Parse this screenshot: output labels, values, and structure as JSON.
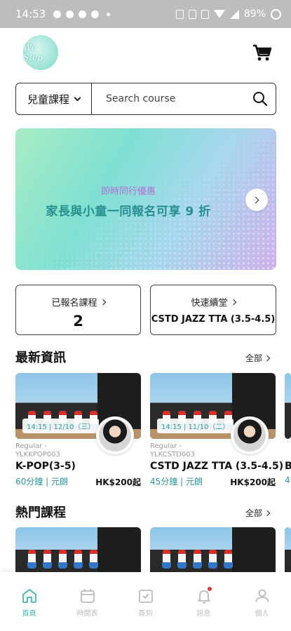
{
  "status_bar": {
    "time": "14:53",
    "battery": "89%"
  },
  "header": {
    "logo_text": "Wé Step"
  },
  "search": {
    "category": "兒童課程",
    "placeholder": "Search course"
  },
  "banner": {
    "subtitle": "即時同行優惠",
    "title": "家長與小童一同報名可享 9 折"
  },
  "quick_cards": {
    "enrolled": {
      "label": "已報名課程",
      "count": "2"
    },
    "quick_checkin": {
      "label": "快速續堂",
      "course": "CSTD JAZZ TTA (3.5-4.5)"
    }
  },
  "news": {
    "title": "最新資訊",
    "more": "全部",
    "courses": [
      {
        "date": "14:15 | 12/10（三）",
        "code_line1": "Regular -",
        "code_line2": "YLKKPOP003",
        "name": "K-POP(3-5)",
        "meta": "60分鐘 | 元朗",
        "price": "HK$200起"
      },
      {
        "date": "14:15 | 11/10（二）",
        "code_line1": "Regular -",
        "code_line2": "YLKCSTD003",
        "name": "CSTD JAZZ TTA (3.5-4.5)",
        "meta": "45分鐘 | 元朗",
        "price": "HK$200起"
      }
    ],
    "peek": {
      "name": "B",
      "meta": "4"
    }
  },
  "hot": {
    "title": "熱門課程",
    "more": "全部"
  },
  "bottom_nav": [
    {
      "label": "首頁",
      "icon": "home-icon",
      "active": true
    },
    {
      "label": "時間表",
      "icon": "calendar-icon",
      "active": false
    },
    {
      "label": "簽到",
      "icon": "checkin-icon",
      "active": false
    },
    {
      "label": "訊息",
      "icon": "bell-icon",
      "active": false
    },
    {
      "label": "個人",
      "icon": "profile-icon",
      "active": false
    }
  ],
  "colors": {
    "accent": "#3db6b0",
    "banner_title": "#27908f",
    "banner_subtitle": "#b46fd2",
    "notification": "#e53935"
  }
}
